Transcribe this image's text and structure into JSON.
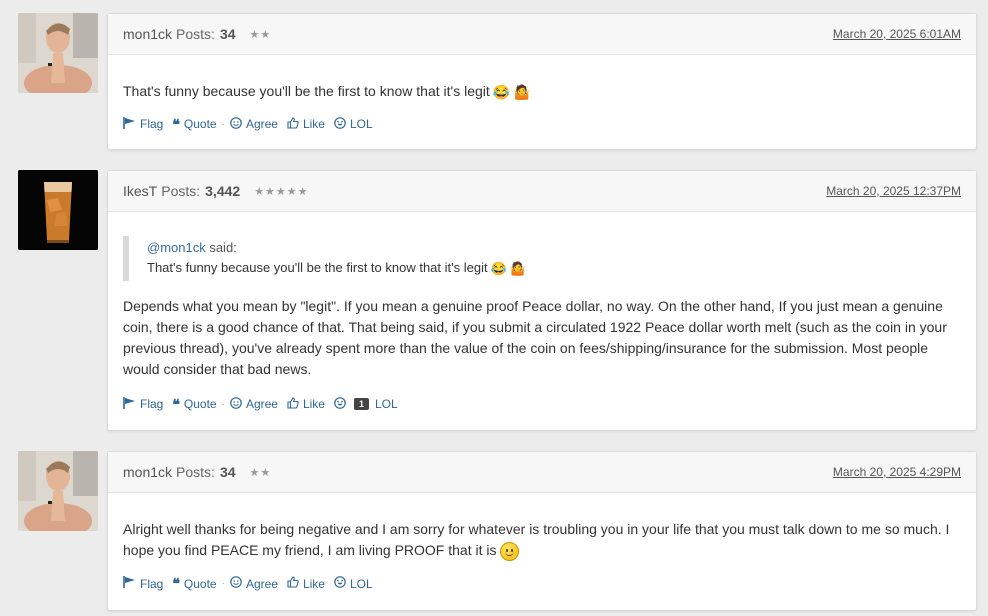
{
  "posts": [
    {
      "username": "mon1ck",
      "posts_label": "Posts:",
      "post_count": "34",
      "stars": "★★",
      "date": "March 20, 2025 6:01AM",
      "message": "That's funny because you'll be the first to know that it's legit",
      "emojis": [
        "😂",
        "🤷"
      ],
      "actions": {
        "flag": "Flag",
        "quote": "Quote",
        "agree": "Agree",
        "like": "Like",
        "lol": "LOL"
      }
    },
    {
      "username": "IkesT",
      "posts_label": "Posts:",
      "post_count": "3,442",
      "stars": "★★★★★",
      "date": "March 20, 2025 12:37PM",
      "quote": {
        "author": "@mon1ck",
        "said": " said:",
        "text": "That's funny because you'll be the first to know that it's legit"
      },
      "message": "Depends what you mean by \"legit\". If you mean a genuine proof Peace dollar, no way. On the other hand, If you just mean a genuine coin, there is a good chance of that. That being said, if you submit a circulated 1922 Peace dollar worth melt (such as the coin in your previous thread), you've already spent more than the value of the coin on fees/shipping/insurance for the submission. Most people would consider that bad news.",
      "lol_count": "1",
      "actions": {
        "flag": "Flag",
        "quote": "Quote",
        "agree": "Agree",
        "like": "Like",
        "lol": "LOL"
      }
    },
    {
      "username": "mon1ck",
      "posts_label": "Posts:",
      "post_count": "34",
      "stars": "★★",
      "date": "March 20, 2025 4:29PM",
      "message": "Alright well thanks for being negative and I am sorry for whatever is troubling you in your life that you must talk down to me so much. I hope you find PEACE my friend, I am living PROOF that it is",
      "actions": {
        "flag": "Flag",
        "quote": "Quote",
        "agree": "Agree",
        "like": "Like",
        "lol": "LOL"
      }
    }
  ],
  "colors": {
    "link": "#2f6796",
    "header_bg": "#f7f7f7",
    "page_bg": "#ececec"
  }
}
